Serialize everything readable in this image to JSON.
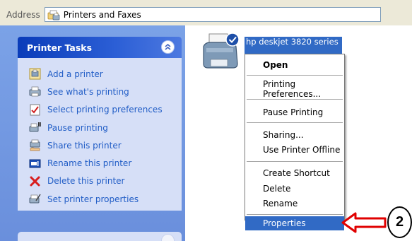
{
  "address_bar": {
    "label": "Address",
    "value": "Printers and Faxes",
    "icon": "printers-folder-icon"
  },
  "task_pane": {
    "title": "Printer Tasks",
    "collapse_icon": "chevron-up-double-icon",
    "items": [
      {
        "label": "Add a printer",
        "icon": "add-printer-icon"
      },
      {
        "label": "See what's printing",
        "icon": "print-queue-icon"
      },
      {
        "label": "Select printing preferences",
        "icon": "preferences-icon"
      },
      {
        "label": "Pause printing",
        "icon": "pause-printer-icon"
      },
      {
        "label": "Share this printer",
        "icon": "share-printer-icon"
      },
      {
        "label": "Rename this printer",
        "icon": "rename-icon"
      },
      {
        "label": "Delete this printer",
        "icon": "delete-x-icon"
      },
      {
        "label": "Set printer properties",
        "icon": "printer-properties-icon"
      }
    ]
  },
  "printer": {
    "label": "hp deskjet 3820 series",
    "icon": "printer-default-check-icon"
  },
  "context_menu": {
    "items": [
      {
        "label": "Open",
        "default": true
      },
      {
        "label": "Printing Preferences..."
      },
      {
        "label": "Pause Printing"
      },
      {
        "label": "Sharing..."
      },
      {
        "label": "Use Printer Offline"
      },
      {
        "label": "Create Shortcut"
      },
      {
        "label": "Delete"
      },
      {
        "label": "Rename"
      },
      {
        "label": "Properties",
        "selected": true
      }
    ]
  },
  "annotation": {
    "step_number": "2",
    "arrow_color": "#e00000"
  },
  "colors": {
    "selection": "#316ac5",
    "task_link": "#215dc6",
    "task_header": "#0a3cb9",
    "task_pane_bg": "#7ba2e7"
  }
}
